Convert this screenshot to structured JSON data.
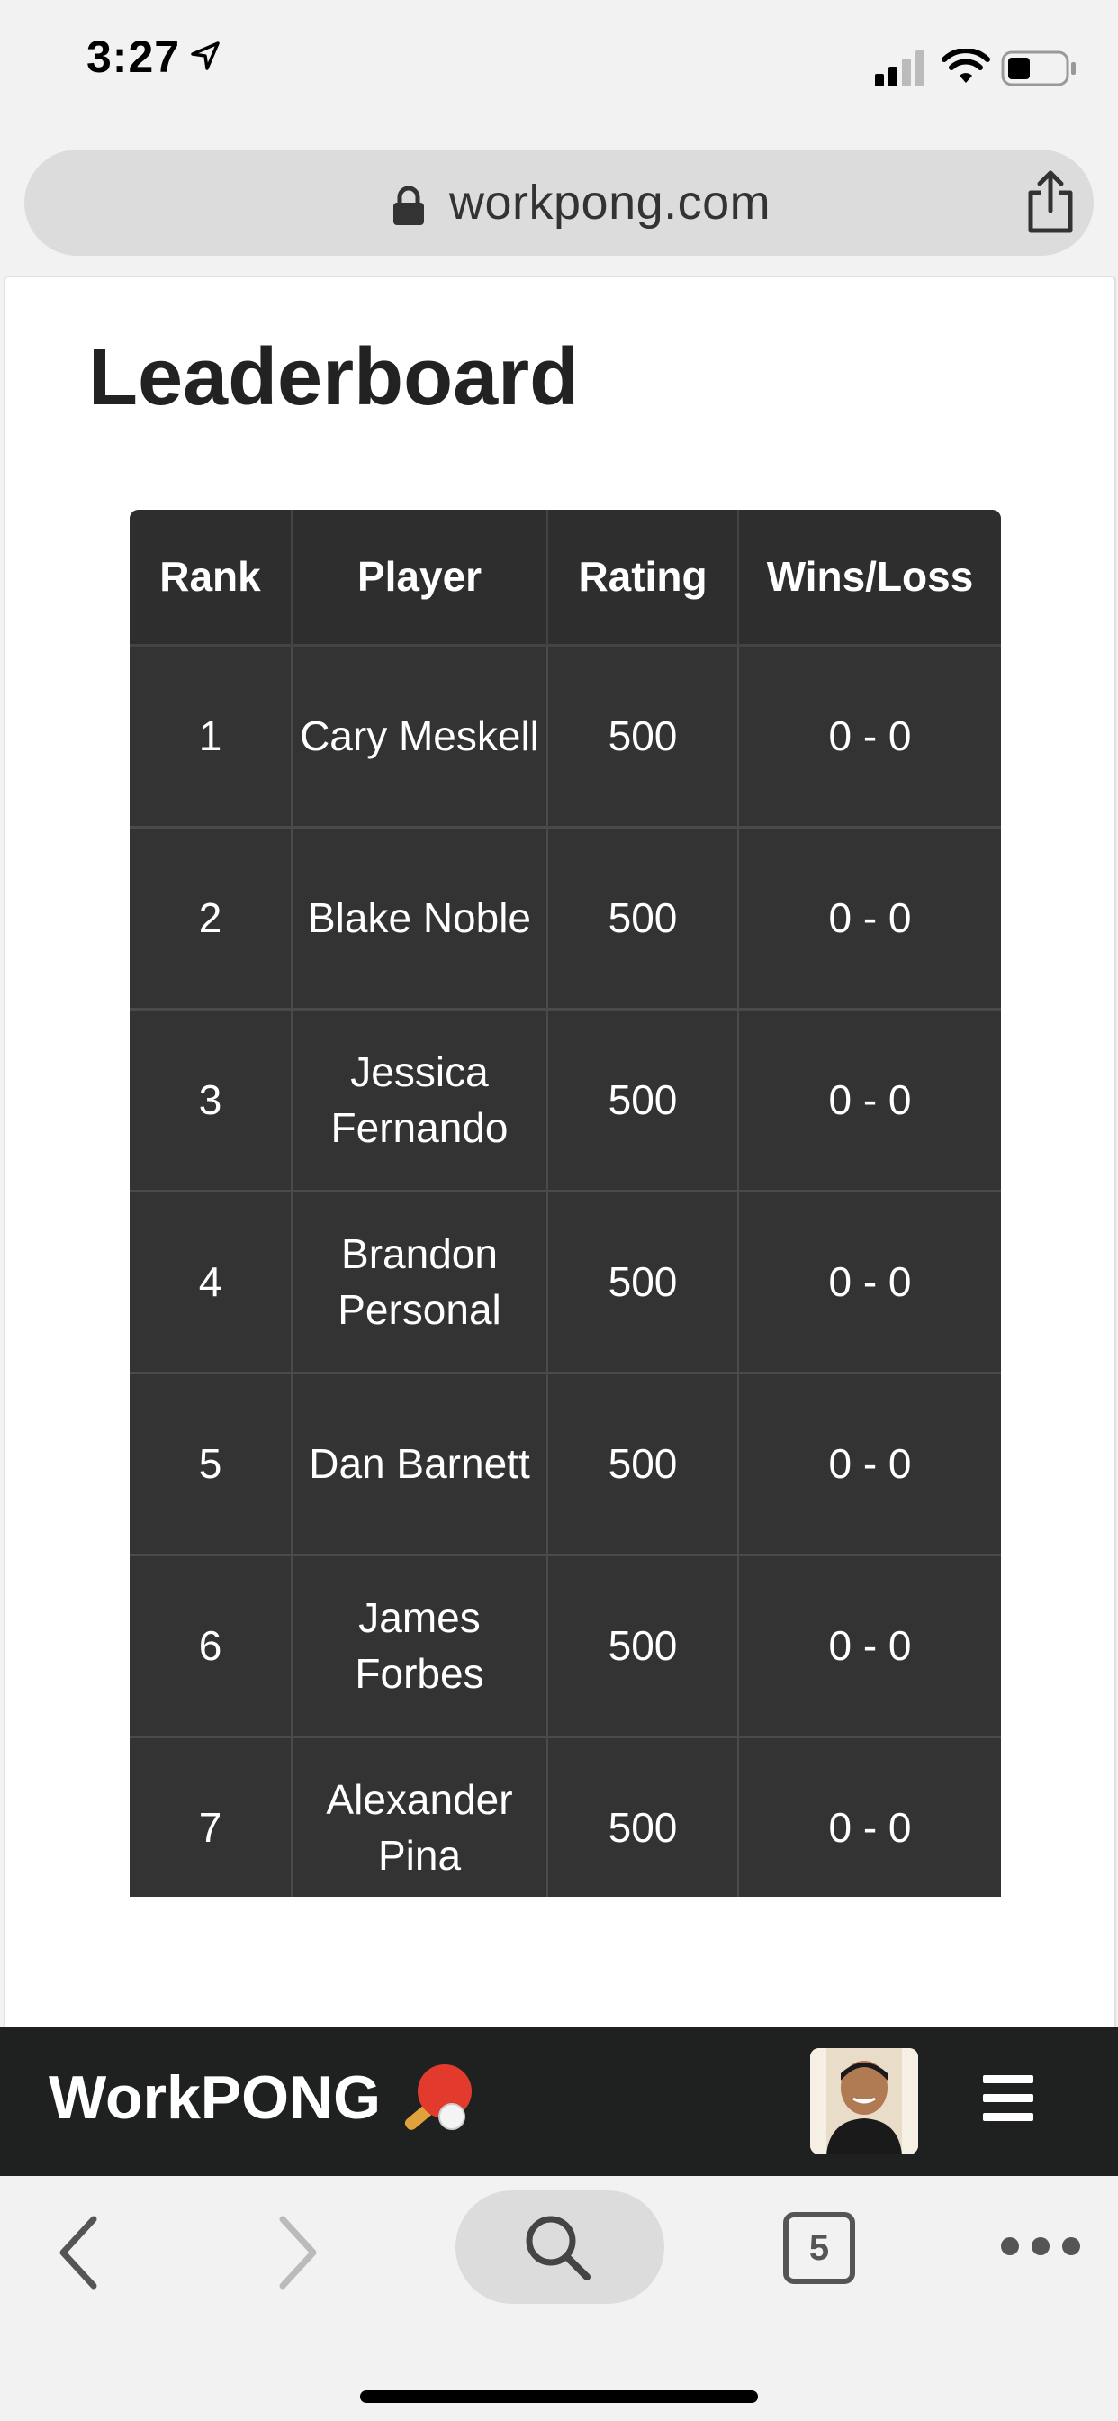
{
  "status_bar": {
    "time": "3:27"
  },
  "browser": {
    "url": "workpong.com",
    "tab_count": "5"
  },
  "page": {
    "title": "Leaderboard"
  },
  "table": {
    "headers": [
      "Rank",
      "Player",
      "Rating",
      "Wins/Loss"
    ],
    "rows": [
      {
        "rank": "1",
        "player": "Cary Meskell",
        "rating": "500",
        "record": "0 - 0"
      },
      {
        "rank": "2",
        "player": "Blake Noble",
        "rating": "500",
        "record": "0 - 0"
      },
      {
        "rank": "3",
        "player": "Jessica Fernando",
        "rating": "500",
        "record": "0 - 0"
      },
      {
        "rank": "4",
        "player": "Brandon Personal",
        "rating": "500",
        "record": "0 - 0"
      },
      {
        "rank": "5",
        "player": "Dan Barnett",
        "rating": "500",
        "record": "0 - 0"
      },
      {
        "rank": "6",
        "player": "James Forbes",
        "rating": "500",
        "record": "0 - 0"
      },
      {
        "rank": "7",
        "player": "Alexander Pina",
        "rating": "500",
        "record": "0 - 0"
      }
    ]
  },
  "site_nav": {
    "brand": "WorkPONG",
    "brand_icon": "ping-pong-paddle-icon",
    "menu_icon": "hamburger-menu-icon"
  },
  "colors": {
    "table_bg": "#333333",
    "nav_bg": "#1f2020",
    "accent": "#ffffff"
  }
}
